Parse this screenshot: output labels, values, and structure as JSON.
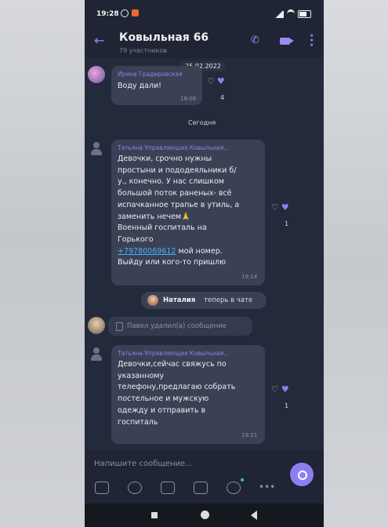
{
  "status_bar": {
    "time": "19:28"
  },
  "chat_header": {
    "title": "Ковыльная 66",
    "subtitle": "79 участников"
  },
  "date_separator": "25.02.2022",
  "today_label": "Сегодня",
  "messages": [
    {
      "sender": "Ирина Градировская",
      "lines": [
        "Воду дали!"
      ],
      "time": "18:06",
      "like_count": "4"
    },
    {
      "sender": "Татьяна Управляющая Ковыльная...",
      "lines": [
        "Девочки, срочно нужны",
        "простыни и пододеяльники б/",
        "у., конечно. У нас слишком",
        "большой поток раненых- всё",
        "испачканное трапье в утиль, а",
        "заменить нечем🙏",
        "Военный госпиталь на",
        "Горького"
      ],
      "phone_link": "+79780069612",
      "phone_suffix": "мой номер.",
      "last_line": "Выйду или кого-то пришлю",
      "time": "19:14",
      "like_count": "1"
    },
    {
      "sender": "Татьяна Управляющая Ковыльная...",
      "lines": [
        "Девочки,сейчас свяжусь по",
        "указанному",
        "телефону,предлагаю собрать",
        "постельное и мужскую",
        "одежду  и отправить  в",
        "госпиталь"
      ],
      "time": "19:21",
      "like_count": "1"
    }
  ],
  "system_notice": {
    "name": "Наталия",
    "text": "теперь в чате"
  },
  "deleted_notice": "Павел удалил(а) сообщение",
  "composer": {
    "placeholder": "Напишите сообщение..."
  },
  "colors": {
    "background": "#232a3b",
    "bubble": "#3a4155",
    "accent": "#8e7ff0",
    "sender_name": "#8f82e6",
    "link": "#46b5f6"
  },
  "icons": {
    "header": [
      "back-arrow-icon",
      "phone-call-icon",
      "video-call-icon",
      "more-vertical-icon"
    ],
    "composer_tools": [
      "sticker-icon",
      "emoji-icon",
      "camera-icon",
      "gif-icon",
      "timer-icon",
      "more-horizontal-icon"
    ],
    "send": "send-voice-icon",
    "navbar": [
      "recent-apps-icon",
      "home-icon",
      "back-icon"
    ]
  }
}
